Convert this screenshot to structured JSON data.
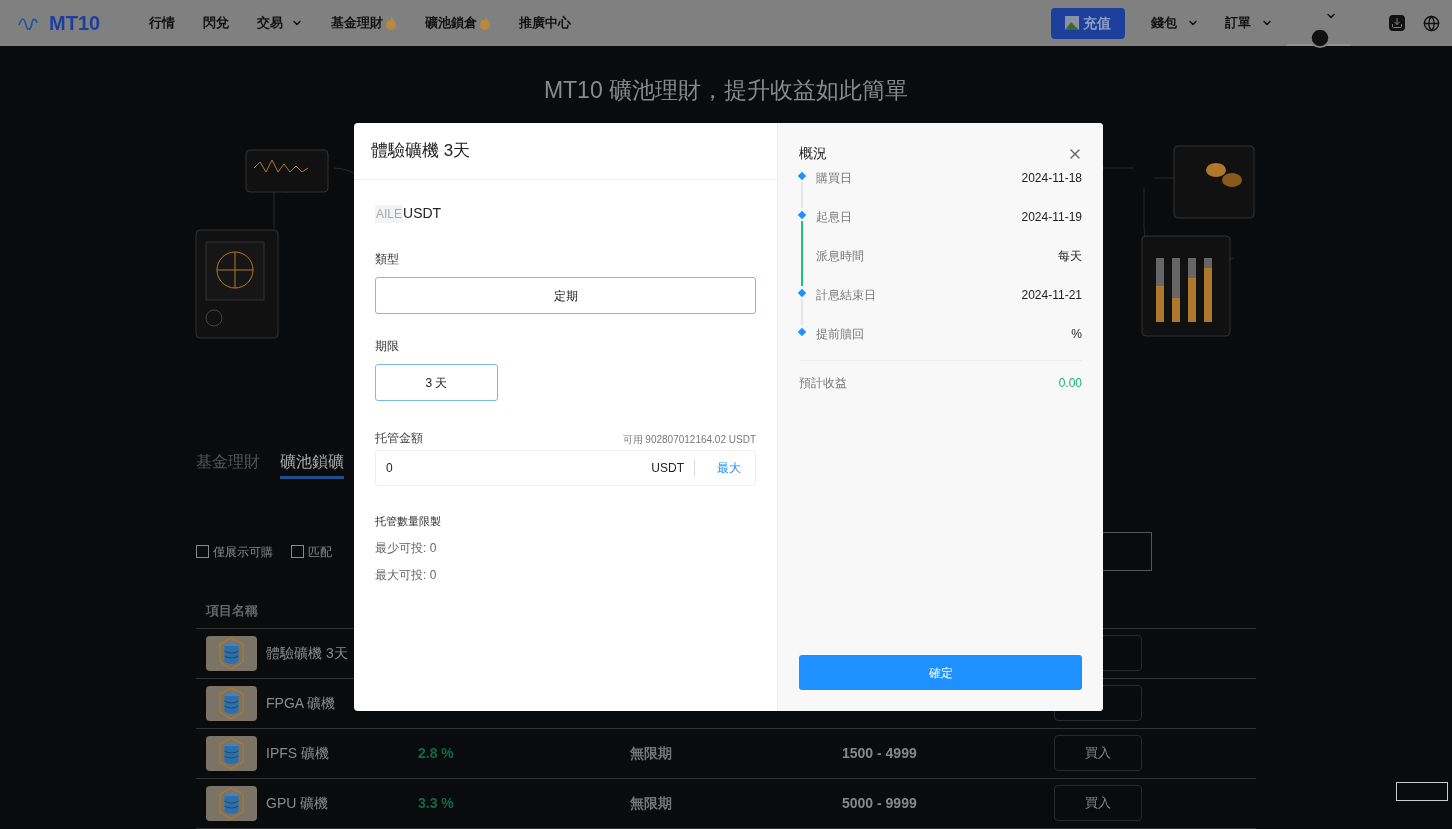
{
  "nav": {
    "logo": "MT10",
    "items": [
      {
        "label": "行情",
        "dropdown": false,
        "hot": false
      },
      {
        "label": "閃兌",
        "dropdown": false,
        "hot": false
      },
      {
        "label": "交易",
        "dropdown": true,
        "hot": false
      },
      {
        "label": "基金理財",
        "dropdown": false,
        "hot": true
      },
      {
        "label": "礦池鎖倉",
        "dropdown": false,
        "hot": true
      },
      {
        "label": "推廣中心",
        "dropdown": false,
        "hot": false
      }
    ],
    "deposit": "充值",
    "menus": [
      {
        "label": "錢包"
      },
      {
        "label": "訂單"
      }
    ]
  },
  "hero": {
    "title": "MT10 礦池理財，提升收益如此簡單"
  },
  "tabs": [
    {
      "label": "基金理財",
      "selected": false
    },
    {
      "label": "礦池鎖礦",
      "selected": true
    }
  ],
  "filters": [
    {
      "label": "僅展示可購",
      "checked": false
    },
    {
      "label": "匹配",
      "checked": false
    }
  ],
  "table": {
    "column_1": "項目名稱",
    "rows": [
      {
        "name": "體驗礦機 3天"
      },
      {
        "name": "FPGA 礦機"
      },
      {
        "name": "IPFS 礦機",
        "rate": "2.8 %",
        "term": "無限期",
        "range": "1500 - 4999",
        "action": "買入"
      },
      {
        "name": "GPU 礦機",
        "rate": "3.3 %",
        "term": "無限期",
        "range": "5000 - 9999",
        "action": "買入"
      }
    ]
  },
  "modal": {
    "title": "體驗礦機 3天",
    "coin_alt": "AILE",
    "coin": "USDT",
    "type_label": "類型",
    "type_value": "定期",
    "term_label": "期限",
    "term_options": [
      {
        "label": "3 天",
        "selected": true
      }
    ],
    "amount_label": "托管金額",
    "available": "可用 902807012164.02 USDT",
    "amount_value": "0",
    "amount_unit": "USDT",
    "max": "最大",
    "limits_title": "托管數量限製",
    "limits": [
      "最少可投: 0",
      "最大可投: 0"
    ],
    "overview_title": "概況",
    "timeline": [
      {
        "label": "購買日",
        "value": "2024-11-18",
        "dot": true,
        "line": true,
        "active": false
      },
      {
        "label": "起息日",
        "value": "2024-11-19",
        "dot": true,
        "line": true,
        "active": true
      },
      {
        "label": "派息時間",
        "value": "每天",
        "dot": false,
        "line": true,
        "active": true
      },
      {
        "label": "計息結束日",
        "value": "2024-11-21",
        "dot": true,
        "line": true,
        "active": false
      },
      {
        "label": "提前贖回",
        "value": "%",
        "dot": true,
        "line": false
      }
    ],
    "estimate_label": "預計收益",
    "estimate_value": "0.00",
    "confirm": "確定"
  }
}
